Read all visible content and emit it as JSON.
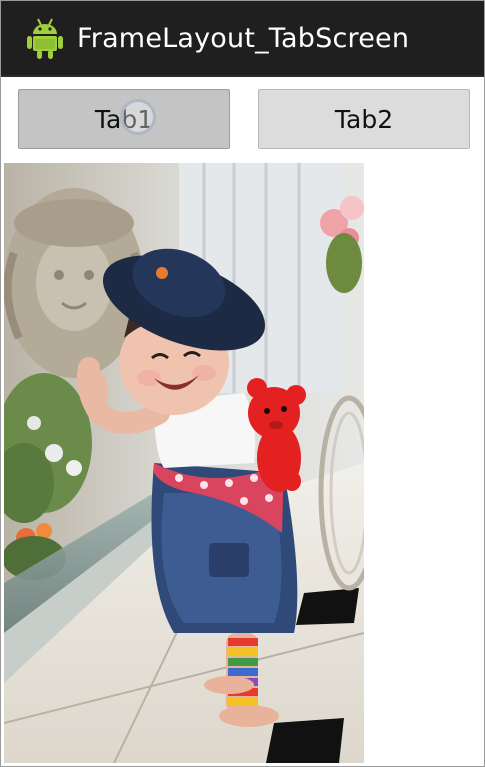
{
  "action_bar": {
    "title": "FrameLayout_TabScreen",
    "icon": "android-robot-icon",
    "background_color": "#1f1f1f"
  },
  "tabs": [
    {
      "label": "Tab1",
      "state": "pressed"
    },
    {
      "label": "Tab2",
      "state": "normal"
    }
  ],
  "content": {
    "image_icon": "child-photo",
    "description_colors": {
      "hat": "#1d2a44",
      "teddy": "#e42121",
      "floor": "#e9e5dd"
    }
  }
}
